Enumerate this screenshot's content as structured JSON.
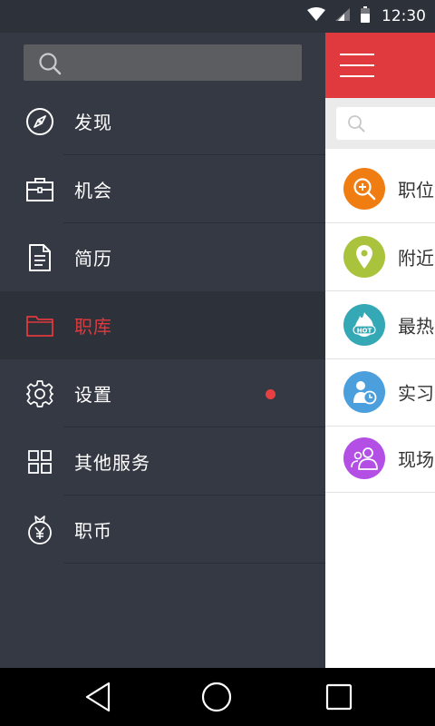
{
  "status": {
    "time": "12:30"
  },
  "drawer": {
    "search": {
      "placeholder": ""
    },
    "items": [
      {
        "label": "发现",
        "icon": "compass-icon"
      },
      {
        "label": "机会",
        "icon": "briefcase-icon"
      },
      {
        "label": "简历",
        "icon": "document-icon"
      },
      {
        "label": "职库",
        "icon": "folder-icon",
        "active": true
      },
      {
        "label": "设置",
        "icon": "gear-icon",
        "badge": "dot"
      },
      {
        "label": "其他服务",
        "icon": "grid-icon"
      },
      {
        "label": "职币",
        "icon": "money-bag-icon"
      }
    ]
  },
  "main": {
    "rows": [
      {
        "label": "职位",
        "icon": "search-plus-icon",
        "color": "#f07d12"
      },
      {
        "label": "附近",
        "icon": "location-pin-icon",
        "color": "#a9c43c"
      },
      {
        "label": "最热",
        "icon": "hot-icon",
        "color": "#35a8b5"
      },
      {
        "label": "实习",
        "icon": "intern-clock-icon",
        "color": "#4b9fdc"
      },
      {
        "label": "现场",
        "icon": "people-icon",
        "color": "#b44fe6"
      }
    ]
  },
  "colors": {
    "accent": "#e0393e",
    "drawer_bg": "#353944",
    "active_bg": "#2d313a"
  }
}
